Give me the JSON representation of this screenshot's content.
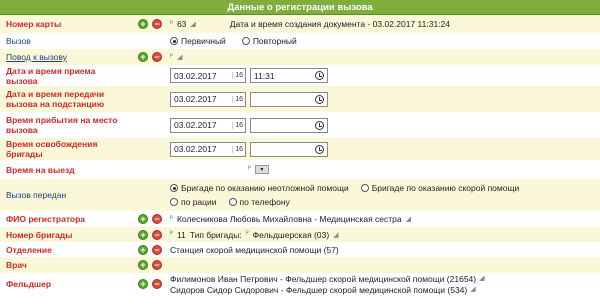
{
  "header": {
    "title": "Данные о регистрации вызова"
  },
  "card": {
    "label": "Номер карты",
    "value": "63",
    "created": "Дата и время создания документа - 03.02.2017 11:31:24"
  },
  "call": {
    "label": "Вызов",
    "options": [
      "Первичный",
      "Повторный"
    ],
    "selected": 0
  },
  "reason": {
    "label": "Повод к вызову"
  },
  "received": {
    "label": "Дата и время приема вызова",
    "date": "03.02.2017",
    "day": "16",
    "time": "11:31"
  },
  "transfer": {
    "label": "Дата и время передачи вызова на подстанцию",
    "date": "03.02.2017",
    "day": "16",
    "time": ""
  },
  "arrival": {
    "label": "Время прибытия на место вызова",
    "date": "03.02.2017",
    "day": "16",
    "time": ""
  },
  "release": {
    "label": "Время освобождения бригады",
    "date": "03.02.2017",
    "day": "16",
    "time": ""
  },
  "departure": {
    "label": "Время на выезд"
  },
  "handover": {
    "label": "Вызов передан",
    "options": [
      "Бригаде по оказанию неотложной помощи",
      "Бригаде по оказанию скорой помощи",
      "по рации",
      "по телефону"
    ],
    "selected": 0
  },
  "registrar": {
    "label": "ФИО регистратора",
    "value": "Колесникова Любовь Михайловна - Медицинская сестра"
  },
  "brigade": {
    "label": "Номер бригады",
    "number": "11",
    "type": "Тип бригады:",
    "type_value": "Фельдшерская (03)"
  },
  "department": {
    "label": "Отделение",
    "value": "Станция скорой медицинской помощи (57)"
  },
  "doctor": {
    "label": "Врач"
  },
  "paramedic": {
    "label": "Фельдшер",
    "values": [
      "Филимонов Иван Петрович - Фельдшер скорой медицинской помощи (21654)",
      "Сидоров Сидор Сидорович - Фельдшер скорой медицинской помощи (534)"
    ]
  },
  "colors": {
    "header": "#7fae3c",
    "label_red": "#cc2a2a",
    "label_blue": "#23427a",
    "row_tint": "#fbf8d9"
  }
}
